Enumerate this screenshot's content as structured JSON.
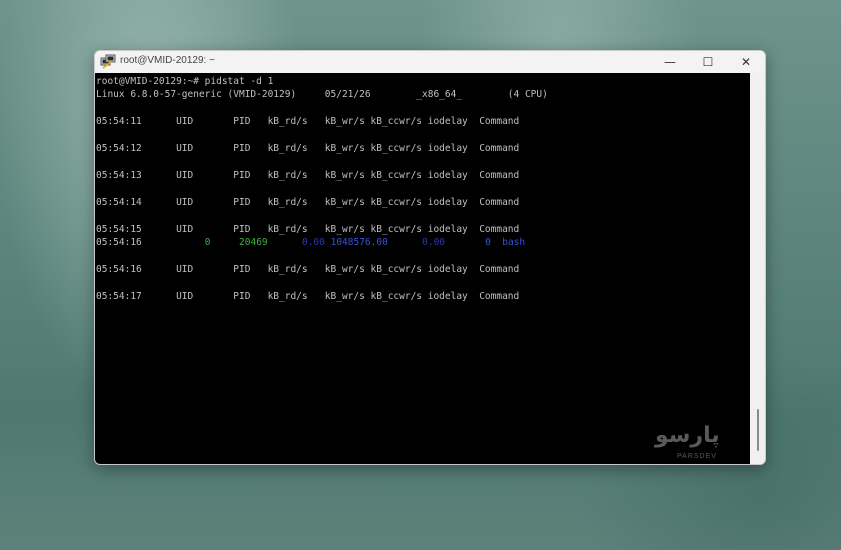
{
  "window": {
    "title": "root@VMID-20129: ~",
    "minimize_glyph": "—",
    "maximize_glyph": "☐",
    "close_glyph": "✕"
  },
  "terminal": {
    "lines": [
      "root@VMID-20129:~# pidstat -d 1",
      "Linux 6.8.0-57-generic (VMID-20129)     05/21/26        _x86_64_        (4 CPU)",
      "",
      "05:54:11      UID       PID   kB_rd/s   kB_wr/s kB_ccwr/s iodelay  Command",
      "",
      "05:54:12      UID       PID   kB_rd/s   kB_wr/s kB_ccwr/s iodelay  Command",
      "",
      "05:54:13      UID       PID   kB_rd/s   kB_wr/s kB_ccwr/s iodelay  Command",
      "",
      "05:54:14      UID       PID   kB_rd/s   kB_wr/s kB_ccwr/s iodelay  Command",
      "",
      "05:54:15      UID       PID   kB_rd/s   kB_wr/s kB_ccwr/s iodelay  Command",
      "",
      "",
      "05:54:16      UID       PID   kB_rd/s   kB_wr/s kB_ccwr/s iodelay  Command",
      "",
      "05:54:17      UID       PID   kB_rd/s   kB_wr/s kB_ccwr/s iodelay  Command"
    ],
    "data_row": {
      "time": "05:54:16",
      "uid": "0",
      "pid": "20469",
      "kb_rd": "0.00",
      "kb_wr": "1048576.00",
      "kb_ccwr": "0.00",
      "iodelay": "0",
      "command": "bash"
    }
  },
  "watermark": {
    "logo": "پارسو",
    "subtitle": "PARSDEV"
  },
  "colors": {
    "pid_green": "#3fb04a",
    "value_blue": "#3a4fd8"
  }
}
